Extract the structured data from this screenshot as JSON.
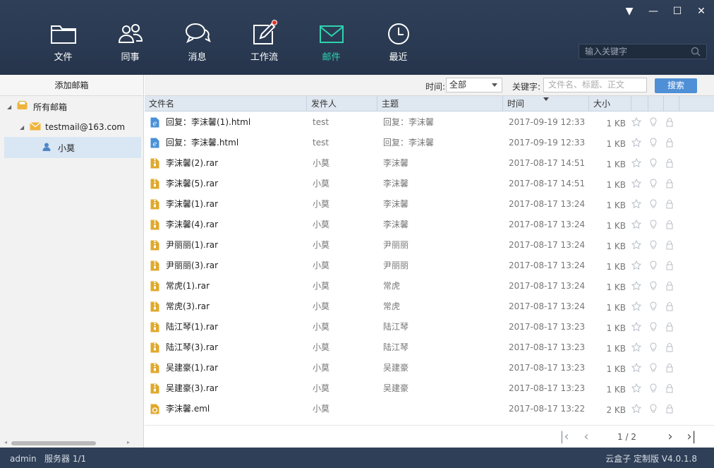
{
  "window": {
    "controls": [
      "▼",
      "—",
      "☐",
      "✕"
    ]
  },
  "nav": [
    {
      "label": "文件",
      "icon": "folder-icon"
    },
    {
      "label": "同事",
      "icon": "contacts-icon"
    },
    {
      "label": "消息",
      "icon": "chat-icon"
    },
    {
      "label": "工作流",
      "icon": "edit-icon"
    },
    {
      "label": "邮件",
      "icon": "mail-icon",
      "active": true
    },
    {
      "label": "最近",
      "icon": "clock-icon"
    }
  ],
  "search": {
    "placeholder": "输入关键字"
  },
  "sidebar": {
    "add_label": "添加邮箱",
    "tree": [
      {
        "label": "所有邮箱",
        "level": 0,
        "icon": "mailbox-icon"
      },
      {
        "label": "testmail@163.com",
        "level": 1,
        "icon": "envelope-icon"
      },
      {
        "label": "小莫",
        "level": 2,
        "icon": "user-icon",
        "selected": true
      }
    ]
  },
  "filter": {
    "time_label": "时间:",
    "time_value": "全部",
    "keyword_label": "关键字:",
    "keyword_placeholder": "文件名、标题、正文",
    "search_button": "搜索"
  },
  "table": {
    "columns": [
      "文件名",
      "发件人",
      "主题",
      "时间",
      "大小"
    ],
    "rows": [
      {
        "name": "回复：李沫馨(1).html",
        "type": "html",
        "from": "test",
        "subject": "回复：李沫馨",
        "time": "2017-09-19 12:33",
        "size": "1 KB"
      },
      {
        "name": "回复：李沫馨.html",
        "type": "html",
        "from": "test",
        "subject": "回复：李沫馨",
        "time": "2017-09-19 12:33",
        "size": "1 KB"
      },
      {
        "name": "李沫馨(2).rar",
        "type": "rar",
        "from": "小莫",
        "subject": "李沫馨",
        "time": "2017-08-17 14:51",
        "size": "1 KB"
      },
      {
        "name": "李沫馨(5).rar",
        "type": "rar",
        "from": "小莫",
        "subject": "李沫馨",
        "time": "2017-08-17 14:51",
        "size": "1 KB"
      },
      {
        "name": "李沫馨(1).rar",
        "type": "rar",
        "from": "小莫",
        "subject": "李沫馨",
        "time": "2017-08-17 13:24",
        "size": "1 KB"
      },
      {
        "name": "李沫馨(4).rar",
        "type": "rar",
        "from": "小莫",
        "subject": "李沫馨",
        "time": "2017-08-17 13:24",
        "size": "1 KB"
      },
      {
        "name": "尹丽丽(1).rar",
        "type": "rar",
        "from": "小莫",
        "subject": "尹丽丽",
        "time": "2017-08-17 13:24",
        "size": "1 KB"
      },
      {
        "name": "尹丽丽(3).rar",
        "type": "rar",
        "from": "小莫",
        "subject": "尹丽丽",
        "time": "2017-08-17 13:24",
        "size": "1 KB"
      },
      {
        "name": "常虎(1).rar",
        "type": "rar",
        "from": "小莫",
        "subject": "常虎",
        "time": "2017-08-17 13:24",
        "size": "1 KB"
      },
      {
        "name": "常虎(3).rar",
        "type": "rar",
        "from": "小莫",
        "subject": "常虎",
        "time": "2017-08-17 13:24",
        "size": "1 KB"
      },
      {
        "name": "陆江琴(1).rar",
        "type": "rar",
        "from": "小莫",
        "subject": "陆江琴",
        "time": "2017-08-17 13:23",
        "size": "1 KB"
      },
      {
        "name": "陆江琴(3).rar",
        "type": "rar",
        "from": "小莫",
        "subject": "陆江琴",
        "time": "2017-08-17 13:23",
        "size": "1 KB"
      },
      {
        "name": "吴建豪(1).rar",
        "type": "rar",
        "from": "小莫",
        "subject": "吴建豪",
        "time": "2017-08-17 13:23",
        "size": "1 KB"
      },
      {
        "name": "吴建豪(3).rar",
        "type": "rar",
        "from": "小莫",
        "subject": "吴建豪",
        "time": "2017-08-17 13:23",
        "size": "1 KB"
      },
      {
        "name": "李沫馨.eml",
        "type": "eml",
        "from": "小莫",
        "subject": "",
        "time": "2017-08-17 13:22",
        "size": "2 KB"
      }
    ]
  },
  "pager": {
    "text": "1 / 2"
  },
  "status": {
    "left": "admin   服务器 1/1",
    "right": "云盒子 定制版 V4.0.1.8"
  },
  "colors": {
    "header": "#2f3f57",
    "active": "#2fd3b0",
    "accent": "#4f8fd6",
    "rar": "#e0a92c",
    "html": "#4a90d6"
  }
}
